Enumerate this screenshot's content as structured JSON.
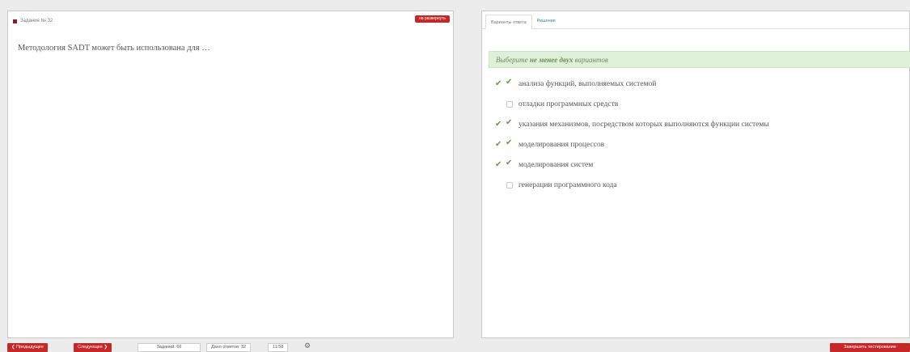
{
  "task": {
    "header": "Задание № 32",
    "expand_label": "на развернуть",
    "question": "Методология SADT может быть использована для …"
  },
  "answer_panel": {
    "tabs": [
      {
        "label": "Варианты ответа",
        "active": true
      },
      {
        "label": "Решение",
        "active": false
      }
    ],
    "hint_prefix": "Выберите",
    "hint_bold": "не менее двух",
    "hint_suffix": "вариантов",
    "options": [
      {
        "label": "анализа функций, выполняемых системой",
        "checked": true,
        "correct": true
      },
      {
        "label": "отладки программных средств",
        "checked": false,
        "correct": false
      },
      {
        "label": "указания механизмов, посредством которых выполняются функции системы",
        "checked": true,
        "correct": true
      },
      {
        "label": "моделирования процессов",
        "checked": true,
        "correct": true
      },
      {
        "label": "моделирования систем",
        "checked": true,
        "correct": true
      },
      {
        "label": "генерации программного кода",
        "checked": false,
        "correct": false
      }
    ]
  },
  "bottom": {
    "prev_label": "❮ Предыдущее",
    "next_label": "Следующее ❯",
    "tasks_count": "Заданий: 66",
    "answered_count": "Дано ответов: 32",
    "time": "11:58",
    "finish_label": "Завершить тестирование"
  },
  "colors": {
    "accent_red": "#c62828",
    "check_green": "#5ea03d",
    "hint_bg": "#dff0d8"
  },
  "icons": {
    "gear": "gear-icon",
    "check": "check-icon"
  }
}
